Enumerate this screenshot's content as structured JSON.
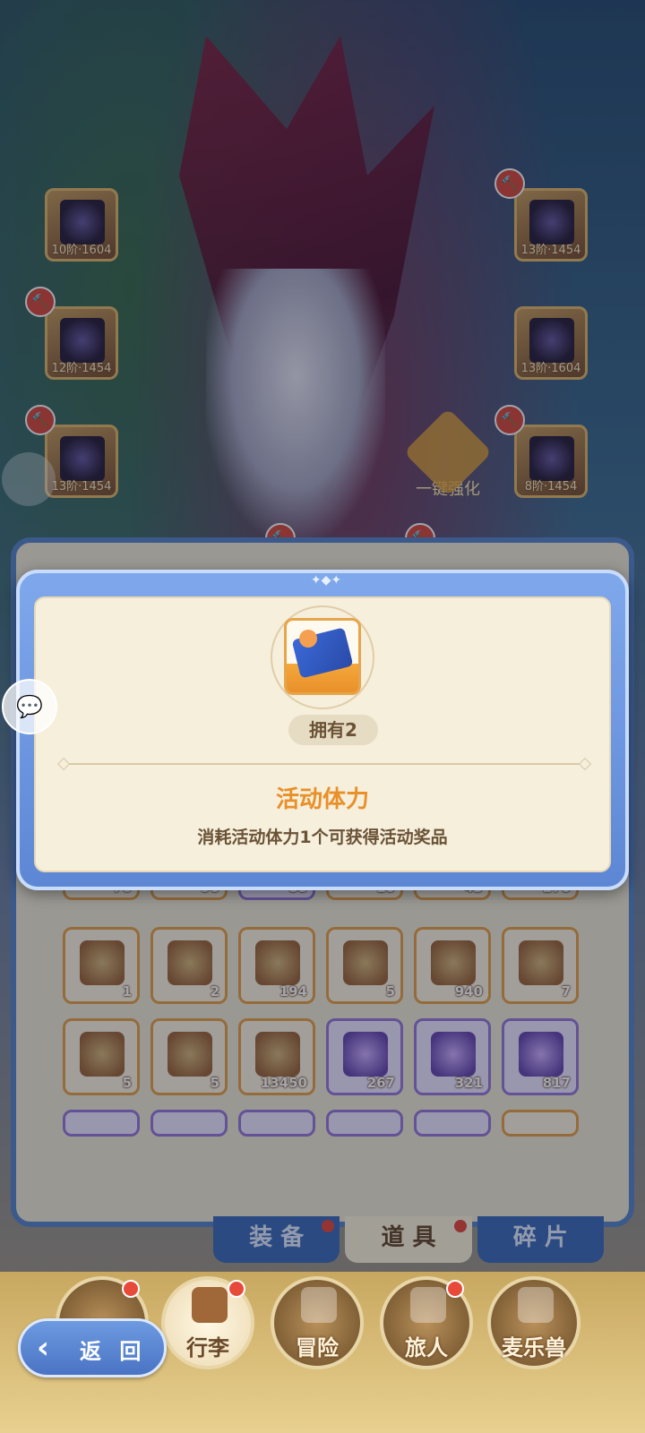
{
  "equipment_slots": [
    {
      "name": "bow",
      "level": "10阶·1604"
    },
    {
      "name": "helmet",
      "level": "13阶·1454"
    },
    {
      "name": "armor",
      "level": "12阶·1454"
    },
    {
      "name": "gauntlet",
      "level": "13阶·1604"
    },
    {
      "name": "belt",
      "level": "13阶·1454"
    },
    {
      "name": "boots",
      "level": "8阶·1454"
    }
  ],
  "enhance_label": "一键强化",
  "popup": {
    "owned": "拥有2",
    "item_name": "活动体力",
    "item_desc": "消耗活动体力1个可获得活动奖品",
    "name_color": "#e8902a"
  },
  "bag": {
    "row_top_counts": [
      "76",
      "90",
      "88",
      "10",
      "45",
      "270"
    ],
    "row2_counts": [
      "1",
      "2",
      "194",
      "5",
      "940",
      "7"
    ],
    "row3_counts": [
      "5",
      "5",
      "13450",
      "267",
      "321",
      "817"
    ],
    "tabs": [
      {
        "label": "装 备",
        "active": false,
        "dot": true
      },
      {
        "label": "道 具",
        "active": true,
        "dot": true
      },
      {
        "label": "碎 片",
        "active": false,
        "dot": false
      }
    ]
  },
  "bottom_nav": {
    "back_label": "返 回",
    "items": [
      {
        "label": "行李",
        "active": true
      },
      {
        "label": "冒险",
        "active": false
      },
      {
        "label": "旅人",
        "active": false
      },
      {
        "label": "麦乐兽",
        "active": false
      }
    ]
  },
  "colors": {
    "popup_frame": "#5d87d4",
    "accent_orange": "#e8902a",
    "badge_red": "#e84a3a"
  }
}
